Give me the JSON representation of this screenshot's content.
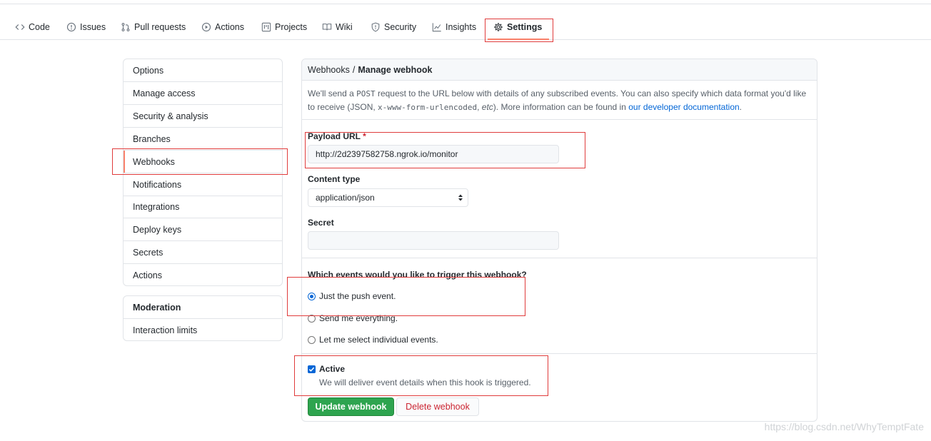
{
  "nav": {
    "tabs": [
      {
        "label": "Code",
        "icon": "code-icon"
      },
      {
        "label": "Issues",
        "icon": "issue-opened-icon"
      },
      {
        "label": "Pull requests",
        "icon": "pull-request-icon"
      },
      {
        "label": "Actions",
        "icon": "play-icon"
      },
      {
        "label": "Projects",
        "icon": "project-icon"
      },
      {
        "label": "Wiki",
        "icon": "book-icon"
      },
      {
        "label": "Security",
        "icon": "shield-icon"
      },
      {
        "label": "Insights",
        "icon": "graph-icon"
      },
      {
        "label": "Settings",
        "icon": "gear-icon",
        "selected": true
      }
    ]
  },
  "sidebar": {
    "items": [
      "Options",
      "Manage access",
      "Security & analysis",
      "Branches",
      "Webhooks",
      "Notifications",
      "Integrations",
      "Deploy keys",
      "Secrets",
      "Actions"
    ],
    "selected": "Webhooks",
    "moderation_heading": "Moderation",
    "moderation_items": [
      "Interaction limits"
    ]
  },
  "breadcrumb": {
    "parent": "Webhooks",
    "separator": "/",
    "current": "Manage webhook"
  },
  "intro": {
    "part1": "We'll send a ",
    "code1": "POST",
    "part2": " request to the URL below with details of any subscribed events. You can also specify which data format you'd like to receive (JSON, ",
    "code2": "x-www-form-urlencoded",
    "part3": ", ",
    "etc": "etc",
    "part4": "). More information can be found in ",
    "link": "our developer documentation",
    "part5": "."
  },
  "form": {
    "payload_url_label": "Payload URL",
    "required_mark": "*",
    "payload_url_value": "http://2d2397582758.ngrok.io/monitor",
    "content_type_label": "Content type",
    "content_type_value": "application/json",
    "secret_label": "Secret",
    "secret_value": "",
    "events_question": "Which events would you like to trigger this webhook?",
    "event_options": [
      "Just the push event.",
      "Send me everything.",
      "Let me select individual events."
    ],
    "event_selected": "Just the push event.",
    "active_label": "Active",
    "active_checked": true,
    "active_note": "We will deliver event details when this hook is triggered."
  },
  "buttons": {
    "update": "Update webhook",
    "delete": "Delete webhook"
  },
  "watermark": "https://blog.csdn.net/WhyTemptFate",
  "colors": {
    "accent_underline": "#f9826c",
    "link": "#0366d6",
    "primary_button": "#2ea44f",
    "danger_text": "#cb2431",
    "annotation": "#e03c3c"
  }
}
